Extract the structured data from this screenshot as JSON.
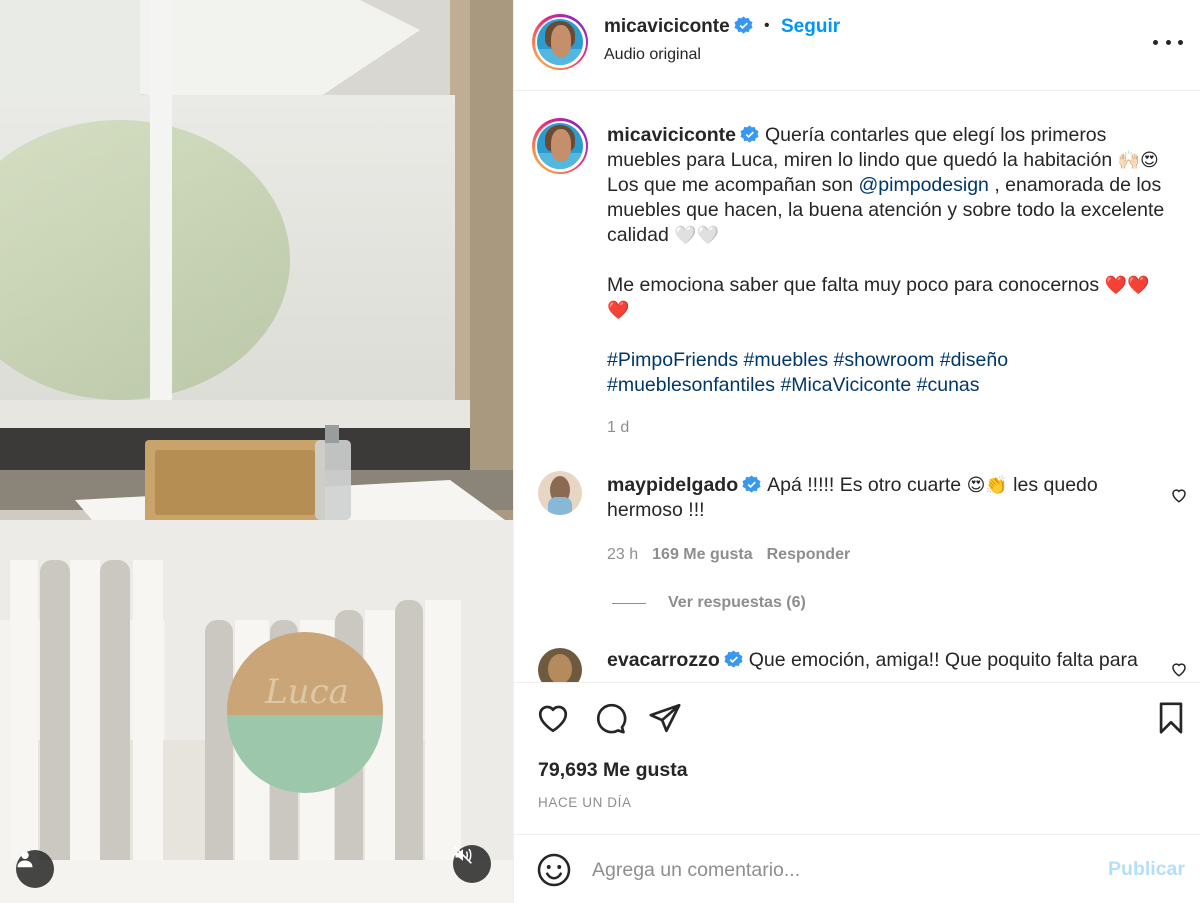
{
  "header": {
    "username": "micaviciconte",
    "separator": "•",
    "follow_label": "Seguir",
    "subtitle": "Audio original"
  },
  "caption": {
    "username": "micaviciconte",
    "line1": "Quería contarles que elegí los primeros",
    "line2": "muebles para Luca, miren lo lindo que quedó la habitación",
    "line2_emoji": "🙌🏻😍",
    "line3_pre": "Los que me acompañan son",
    "line3_mention": "@pimpodesign",
    "line3_post": ", enamorada de los",
    "line4": "muebles que hacen, la buena atención y sobre todo la excelente",
    "line5": "calidad",
    "line5_emoji": "🤍🤍",
    "line6": "Me emociona saber que falta muy poco para conocernos",
    "line6_emoji": "❤️❤️",
    "line7_emoji": "❤️",
    "hashtags_line1": "#PimpoFriends #muebles #showroom #diseño",
    "hashtags_line2": "#mueblesonfantiles #MicaViciconte #cunas",
    "time": "1 d"
  },
  "comments": [
    {
      "username": "maypidelgado",
      "text_line1": "Apá !!!!! Es otro cuarte",
      "emoji": "😍👏",
      "text_line1_post": "les quedo",
      "text_line2": "hermoso !!!",
      "time": "23 h",
      "likes": "169 Me gusta",
      "reply_label": "Responder",
      "view_replies": "Ver respuestas (6)"
    },
    {
      "username": "evacarrozzo",
      "text_line1": "Que emoción, amiga!! Que poquito falta para"
    }
  ],
  "actions": {
    "likes_count": "79,693 Me gusta",
    "date": "HACE UN DÍA"
  },
  "add_comment": {
    "placeholder": "Agrega un comentario...",
    "publish_label": "Publicar"
  },
  "media": {
    "sign_text": "Luca"
  },
  "colors": {
    "link_blue": "#0095f6",
    "hashtag_blue": "#00376b",
    "verified_blue": "#3897f0",
    "muted_gray": "#8e8e8e",
    "publish_disabled": "#b2dffc"
  }
}
